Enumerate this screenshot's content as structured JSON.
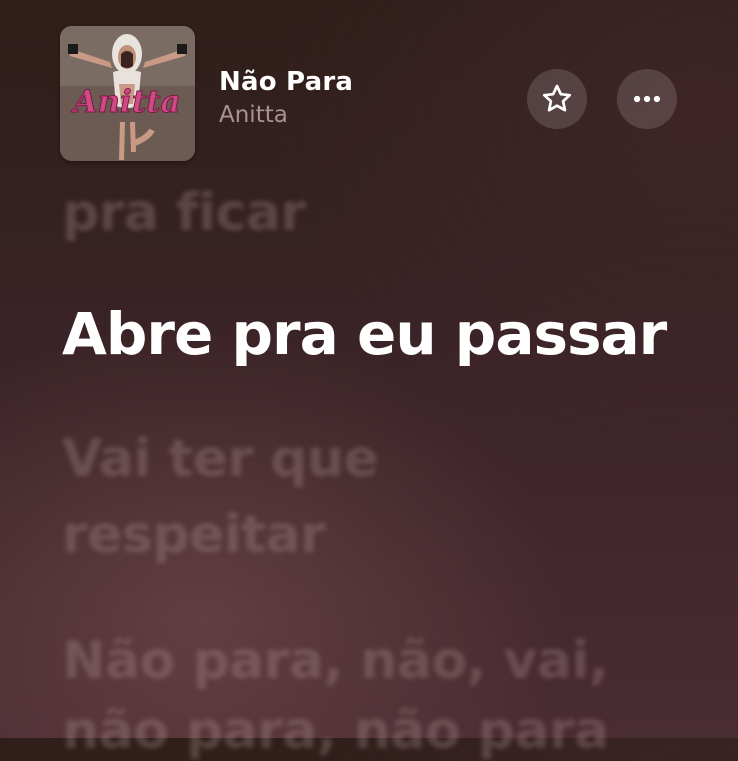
{
  "now_playing": {
    "title": "Não Para",
    "artist": "Anitta",
    "cover_text": "Anitta"
  },
  "actions": {
    "favorite_icon": "star-outline-icon",
    "more_icon": "ellipsis-icon"
  },
  "lyrics": {
    "previous_line": "pra ficar",
    "current_line": "Abre pra eu passar",
    "next_line_1": "Vai ter que",
    "next_line_2": "respeitar",
    "next_line_3": "Não para, não, vai,",
    "next_line_4": "não para, não para"
  },
  "colors": {
    "background_top": "#2f1e1a",
    "background_bottom": "#4a2c33",
    "active_lyric": "#ffffff"
  }
}
